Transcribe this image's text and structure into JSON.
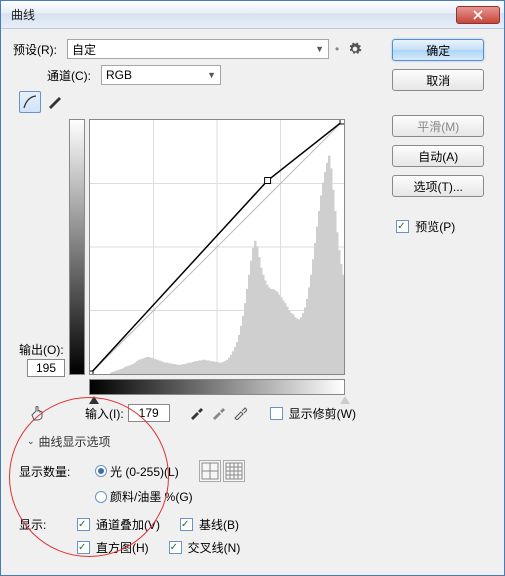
{
  "window": {
    "title": "曲线"
  },
  "preset": {
    "label": "预设(R):",
    "value": "自定"
  },
  "channel": {
    "label": "通道(C):",
    "value": "RGB"
  },
  "buttons": {
    "ok": "确定",
    "cancel": "取消",
    "smooth": "平滑(M)",
    "auto": "自动(A)",
    "options": "选项(T)..."
  },
  "preview": {
    "label": "预览(P)",
    "checked": true
  },
  "output": {
    "label": "输出(O):",
    "value": "195"
  },
  "input": {
    "label": "输入(I):",
    "value": "179"
  },
  "show_clipping": {
    "label": "显示修剪(W)",
    "checked": false
  },
  "disclosure": "曲线显示选项",
  "amount": {
    "label": "显示数量:",
    "light": "光 (0-255)(L)",
    "pigment": "颜料/油墨 %(G)",
    "selected": "light"
  },
  "show": {
    "label": "显示:",
    "channel_overlay": "通道叠加(V)",
    "baseline": "基线(B)",
    "histogram": "直方图(H)",
    "intersection": "交叉线(N)"
  },
  "chart_data": {
    "type": "line",
    "title": "Curves",
    "xlabel": "Input",
    "ylabel": "Output",
    "xlim": [
      0,
      255
    ],
    "ylim": [
      0,
      255
    ],
    "series": [
      {
        "name": "curve",
        "points": [
          [
            0,
            0
          ],
          [
            179,
            195
          ],
          [
            255,
            255
          ]
        ]
      },
      {
        "name": "baseline",
        "points": [
          [
            0,
            0
          ],
          [
            255,
            255
          ]
        ]
      }
    ],
    "histogram": [
      0,
      0,
      0,
      0,
      0,
      0,
      0,
      0,
      0,
      0,
      2,
      3,
      4,
      5,
      6,
      7,
      8,
      10,
      11,
      12,
      13,
      14,
      16,
      18,
      20,
      21,
      22,
      23,
      24,
      24,
      23,
      22,
      21,
      20,
      19,
      18,
      17,
      16,
      16,
      15,
      15,
      14,
      14,
      13,
      13,
      13,
      14,
      14,
      15,
      16,
      16,
      17,
      18,
      18,
      19,
      19,
      20,
      20,
      19,
      19,
      18,
      18,
      17,
      17,
      16,
      16,
      17,
      18,
      20,
      23,
      27,
      32,
      38,
      45,
      55,
      68,
      82,
      100,
      120,
      140,
      160,
      178,
      188,
      180,
      165,
      150,
      140,
      132,
      126,
      122,
      120,
      120,
      118,
      116,
      112,
      108,
      104,
      100,
      95,
      90,
      86,
      84,
      80,
      78,
      77,
      80,
      86,
      94,
      106,
      122,
      140,
      162,
      185,
      208,
      230,
      252,
      270,
      285,
      298,
      308,
      290,
      260,
      230,
      200,
      175,
      155,
      140
    ]
  }
}
